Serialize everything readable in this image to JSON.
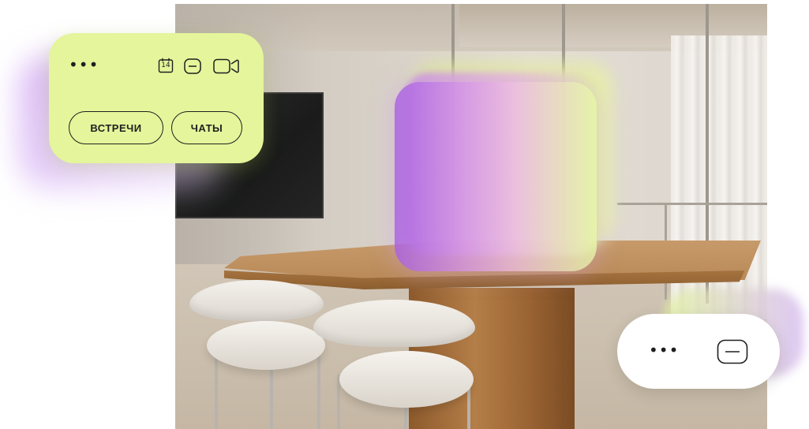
{
  "toolbar_card": {
    "menu_dots": "•••",
    "calendar_day": "14",
    "icons": [
      "calendar-icon",
      "minimize-icon",
      "video-camera-icon"
    ],
    "buttons": {
      "meetings": "ВСТРЕЧИ",
      "chats": "ЧАТЫ"
    },
    "background_color": "#e4f59b"
  },
  "mini_card": {
    "menu_dots": "•••",
    "icons": [
      "minimize-icon"
    ],
    "background_color": "#ffffff"
  },
  "colors": {
    "lime_accent": "#e4f59b",
    "violet_glow": "#aa62e2",
    "ink": "#1f1f1f"
  }
}
